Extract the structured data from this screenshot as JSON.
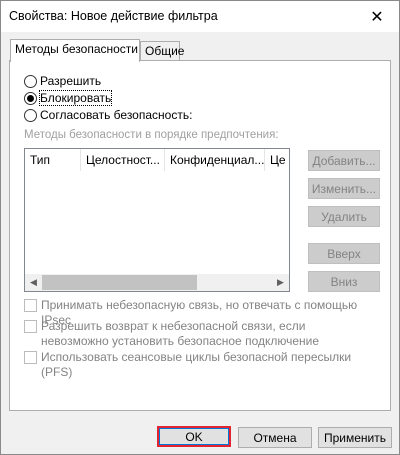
{
  "window": {
    "title": "Свойства: Новое действие фильтра",
    "close_glyph": "✕"
  },
  "tabs": [
    {
      "label": "Методы безопасности",
      "active": true
    },
    {
      "label": "Общие",
      "active": false
    }
  ],
  "radios": [
    {
      "label": "Разрешить",
      "checked": false
    },
    {
      "label": "Блокировать",
      "checked": true
    },
    {
      "label": "Согласовать безопасность:",
      "checked": false
    }
  ],
  "methods_caption": "Методы безопасности в порядке предпочтения:",
  "list": {
    "columns": [
      "Тип",
      "Целостност...",
      "Конфиденциал...",
      "Це"
    ]
  },
  "side_buttons": [
    "Добавить...",
    "Изменить...",
    "Удалить",
    "Вверх",
    "Вниз"
  ],
  "checkboxes": [
    "Принимать небезопасную связь, но отвечать с помощью IPsec",
    "Разрешить возврат к небезопасной связи, если невозможно установить безопасное подключение",
    "Использовать сеансовые циклы безопасной пересылки (PFS)"
  ],
  "footer": {
    "ok": "OK",
    "cancel": "Отмена",
    "apply": "Применить"
  },
  "colors": {
    "highlight": "#e3232f",
    "disabled": "#838383"
  }
}
